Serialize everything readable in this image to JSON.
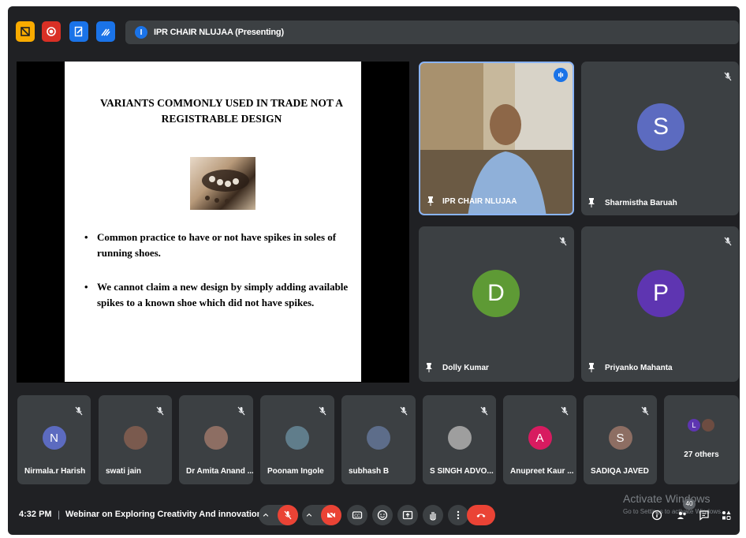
{
  "toolbar": {
    "buttons": [
      {
        "name": "slides-icon",
        "color": "#f9ab00"
      },
      {
        "name": "record-icon",
        "color": "#d93025"
      },
      {
        "name": "edit-document-icon",
        "color": "#1a73e8"
      },
      {
        "name": "whiteboard-icon",
        "color": "#1a73e8"
      }
    ]
  },
  "presenting": {
    "badge": "I",
    "label": "IPR CHAIR NLUJAA (Presenting)"
  },
  "slide": {
    "title_line1": "VARIANTS COMMONLY USED IN  TRADE NOT A",
    "title_line2": "REGISTRABLE DESIGN",
    "bullets": [
      {
        "line1": "Common practice to have or not have  spikes in soles of",
        "line2": "running shoes."
      },
      {
        "line1": "We cannot claim a new design by simply adding available",
        "line2": "spikes to a known shoe which did not have spikes."
      }
    ]
  },
  "main_tiles": [
    {
      "name": "IPR CHAIR NLUJAA",
      "initial": "",
      "color": "",
      "speaking": true
    },
    {
      "name": "Sharmistha Baruah",
      "initial": "S",
      "color": "#5c6bc0"
    },
    {
      "name": "Dolly Kumar",
      "initial": "D",
      "color": "#5e9a35"
    },
    {
      "name": "Priyanko Mahanta",
      "initial": "P",
      "color": "#5e35b1"
    }
  ],
  "strip": [
    {
      "name": "Nirmala.r Harish",
      "initial": "N",
      "color": "#5c6bc0"
    },
    {
      "name": "swati jain",
      "initial": "",
      "color": "#7a5a4e"
    },
    {
      "name": "Dr Amita Anand ...",
      "initial": "",
      "color": "#8d6e63"
    },
    {
      "name": "Poonam Ingole",
      "initial": "",
      "color": "#607d8b"
    },
    {
      "name": "subhash B",
      "initial": "",
      "color": "#5d6d8a"
    },
    {
      "name": "S SINGH ADVO...",
      "initial": "",
      "color": "#9e9e9e"
    },
    {
      "name": "Anupreet Kaur ...",
      "initial": "A",
      "color": "#d81b60"
    },
    {
      "name": "SADIQA JAVED",
      "initial": "S",
      "color": "#8d6e63"
    }
  ],
  "others": {
    "label": "27 others",
    "mini_initial": "L",
    "mini_color": "#5e35b1"
  },
  "bottom": {
    "time": "4:32 PM",
    "separator": "|",
    "meeting_title": "Webinar on Exploring Creativity And innovation i...",
    "participant_count": "40",
    "watermark_line1": "Activate Windows",
    "watermark_line2": "Go to Settings to activate Windows."
  }
}
